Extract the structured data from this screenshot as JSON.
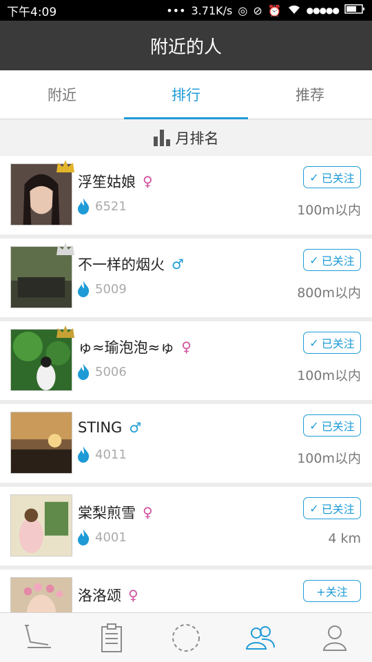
{
  "status_bar": {
    "time": "下午4:09",
    "speed": "3.71K/s",
    "dots": "•••",
    "signal": "●●●●●"
  },
  "header": {
    "title": "附近的人"
  },
  "tabs": [
    {
      "label": "附近",
      "active": false
    },
    {
      "label": "排行",
      "active": true
    },
    {
      "label": "推荐",
      "active": false
    }
  ],
  "section": {
    "title": "月排名"
  },
  "colors": {
    "accent": "#1e9bd7",
    "female": "#d14f9c",
    "header_bg": "#3a3a3a",
    "crown_gold": "#e3b52b",
    "crown_silver": "#d8d8d8"
  },
  "users": [
    {
      "name": "浮笙姑娘",
      "gender": "♀",
      "gender_type": "female",
      "score": "6521",
      "distance": "100m以内",
      "follow_label": "已关注",
      "followed": true,
      "crown": "gold"
    },
    {
      "name": "不一样的烟火",
      "gender": "♂",
      "gender_type": "male",
      "score": "5009",
      "distance": "800m以内",
      "follow_label": "已关注",
      "followed": true,
      "crown": "silver"
    },
    {
      "name": "ゅ≈瑜泡泡≈ゅ",
      "gender": "♀",
      "gender_type": "female",
      "score": "5006",
      "distance": "100m以内",
      "follow_label": "已关注",
      "followed": true,
      "crown": "bronze"
    },
    {
      "name": "STING",
      "gender": "♂",
      "gender_type": "male",
      "score": "4011",
      "distance": "100m以内",
      "follow_label": "已关注",
      "followed": true,
      "crown": "none"
    },
    {
      "name": "棠梨煎雪",
      "gender": "♀",
      "gender_type": "female",
      "score": "4001",
      "distance": "4 km",
      "follow_label": "已关注",
      "followed": true,
      "crown": "none"
    },
    {
      "name": "洛洛颂",
      "gender": "♀",
      "gender_type": "female",
      "score": "",
      "distance": "",
      "follow_label": "+关注",
      "followed": false,
      "crown": "none"
    }
  ],
  "bottom_nav": [
    {
      "icon": "treadmill-icon",
      "active": false
    },
    {
      "icon": "clipboard-icon",
      "active": false
    },
    {
      "icon": "dashed-circle-icon",
      "active": false
    },
    {
      "icon": "people-icon",
      "active": true
    },
    {
      "icon": "person-icon",
      "active": false
    }
  ]
}
